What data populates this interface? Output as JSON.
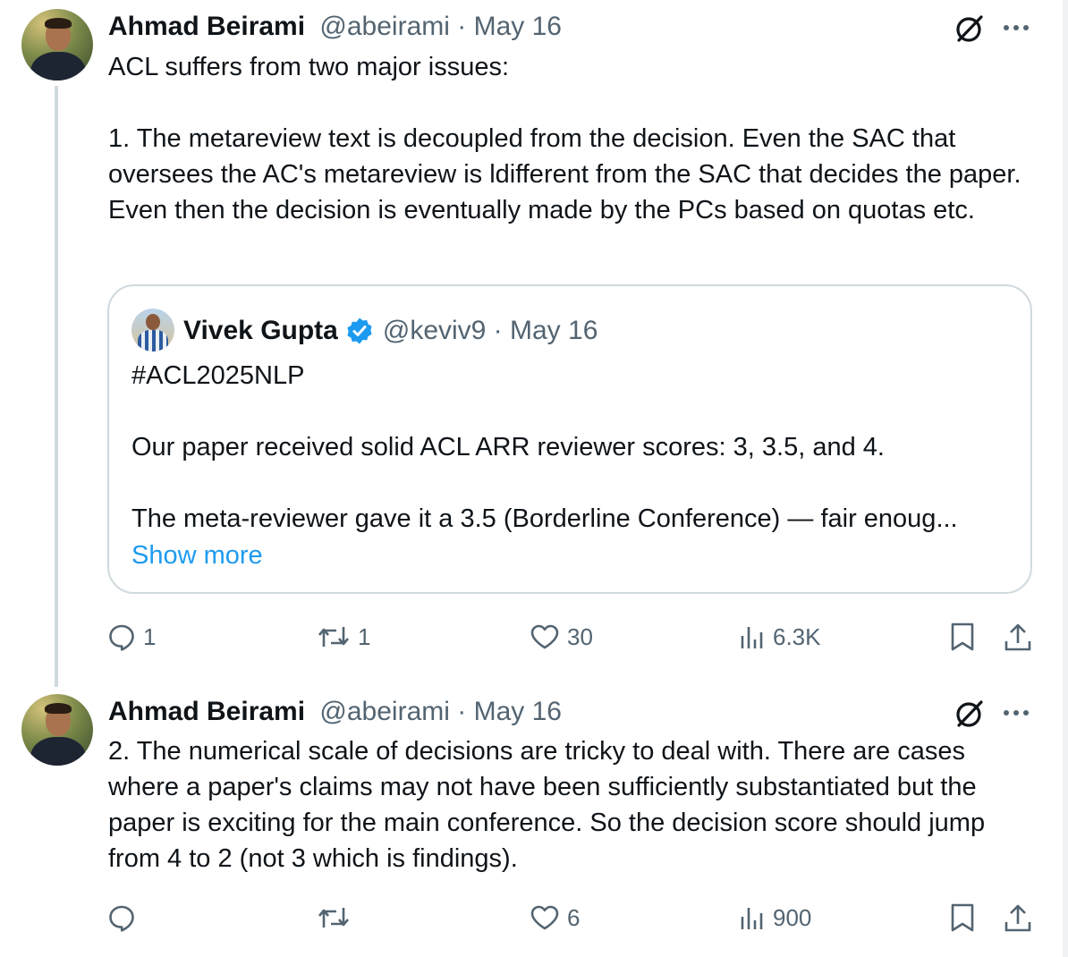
{
  "tweets": [
    {
      "author_name": "Ahmad Beirami",
      "handle_date": "@abeirami · May 16",
      "text": "ACL suffers from two major issues:\n\n1. The metareview text is decoupled from the decision. Even the SAC that oversees the AC's metareview is ldifferent from the SAC that decides the paper. Even then the decision is eventually made by the PCs based on quotas etc.",
      "quote": {
        "author_name": "Vivek Gupta",
        "handle_date": "@keviv9 · May 16",
        "text": "#ACL2025NLP\n\nOur paper received solid ACL ARR reviewer scores: 3, 3.5, and 4.\n\nThe meta-reviewer gave it a 3.5 (Borderline Conference) — fair enoug...",
        "show_more": "Show more"
      },
      "actions": {
        "replies": "1",
        "reposts": "1",
        "likes": "30",
        "views": "6.3K"
      }
    },
    {
      "author_name": "Ahmad Beirami",
      "handle_date": "@abeirami · May 16",
      "text": "2. The numerical scale of decisions are tricky to deal with. There are cases where a paper's claims may not have been sufficiently substantiated but the paper is exciting for the main conference. So the decision score should jump from 4 to 2 (not 3 which is findings).",
      "actions": {
        "replies": "",
        "reposts": "",
        "likes": "6",
        "views": "900"
      }
    }
  ],
  "icons": {
    "grok": "grok-icon",
    "more": "more-icon",
    "reply": "reply-icon",
    "repost": "repost-icon",
    "like": "like-icon",
    "views": "views-icon",
    "bookmark": "bookmark-icon",
    "share": "share-icon",
    "verified": "verified-badge-icon"
  },
  "colors": {
    "link": "#1d9bf0",
    "muted": "#536471",
    "text": "#0f1419",
    "border": "#cfd9de"
  }
}
